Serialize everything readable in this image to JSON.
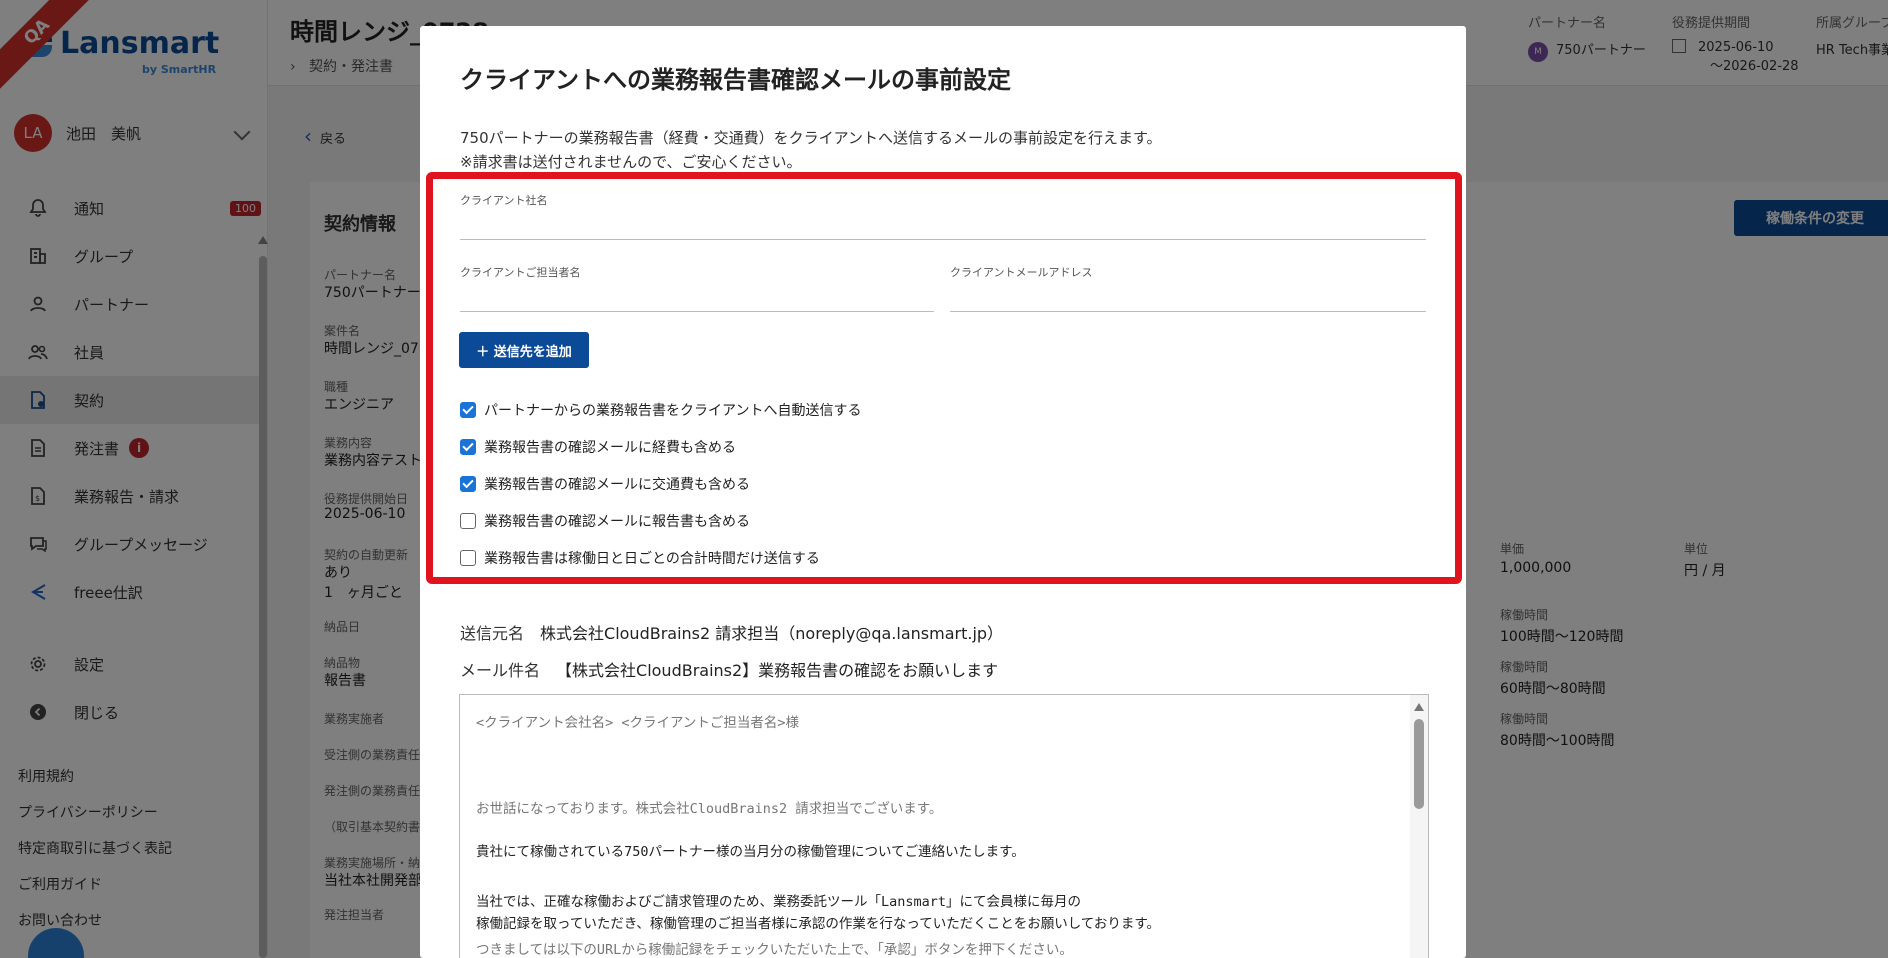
{
  "qa_label": "QA",
  "logo": {
    "name": "Lansmart",
    "sub": "by SmartHR"
  },
  "user": {
    "initials": "LA",
    "name": "池田　美帆"
  },
  "nav": [
    {
      "label": "通知",
      "icon": "bell-icon",
      "badge": "100"
    },
    {
      "label": "グループ",
      "icon": "building-icon"
    },
    {
      "label": "パートナー",
      "icon": "person-icon"
    },
    {
      "label": "社員",
      "icon": "people-icon"
    },
    {
      "label": "契約",
      "icon": "contract-icon",
      "active": true
    },
    {
      "label": "発注書",
      "icon": "document-icon",
      "info": "i"
    },
    {
      "label": "業務報告・請求",
      "icon": "report-icon"
    },
    {
      "label": "グループメッセージ",
      "icon": "chat-icon"
    },
    {
      "label": "freee仕訳",
      "icon": "freee-icon"
    }
  ],
  "nav_bottom": [
    {
      "label": "設定",
      "icon": "gear-icon"
    },
    {
      "label": "閉じる",
      "icon": "close-circle-icon"
    }
  ],
  "footer_links": [
    "利用規約",
    "プライバシーポリシー",
    "特定商取引に基づく表記",
    "ご利用ガイド",
    "お問い合わせ"
  ],
  "header": {
    "title": "時間レンジ_0728",
    "breadcrumb": "契約・発注書",
    "partner_label": "パートナー名",
    "partner_avatar": "M",
    "partner_value": "750パートナー",
    "period_label": "役務提供期間",
    "period_start": "2025-06-10",
    "period_end": "〜2026-02-28",
    "group_label": "所属グループ",
    "group_value": "HR Tech事業"
  },
  "page": {
    "back": "戻る",
    "card_title": "契約情報",
    "change_button": "稼働条件の変更",
    "fields": [
      {
        "label": "パートナー名",
        "value": "750パートナー"
      },
      {
        "label": "案件名",
        "value": "時間レンジ_07"
      },
      {
        "label": "職種",
        "value": "エンジニア"
      },
      {
        "label": "業務内容",
        "value": "業務内容テスト"
      },
      {
        "label": "役務提供開始日",
        "value": "2025-06-10"
      },
      {
        "label": "契約の自動更新",
        "value": "あり"
      },
      {
        "label": "",
        "value": "1　ヶ月ごと"
      },
      {
        "label": "納品日",
        "value": ""
      },
      {
        "label": "納品物",
        "value": "報告書"
      },
      {
        "label": "業務実施者",
        "value": ""
      },
      {
        "label": "受注側の業務責任",
        "value": ""
      },
      {
        "label": "発注側の業務責任",
        "value": ""
      },
      {
        "label": "（取引基本契約書",
        "value": ""
      },
      {
        "label": "業務実施場所・納",
        "value": "当社本社開発部"
      },
      {
        "label": "発注担当者",
        "value": ""
      }
    ],
    "rate_label": "単価",
    "rate_value": "1,000,000",
    "unit_label": "単位",
    "unit_value": "円 / 月",
    "hours": [
      {
        "label": "稼働時間",
        "value": "100時間〜120時間"
      },
      {
        "label": "稼働時間",
        "value": "60時間〜80時間"
      },
      {
        "label": "稼働時間",
        "value": "80時間〜100時間"
      }
    ]
  },
  "modal": {
    "title": "クライアントへの業務報告書確認メールの事前設定",
    "desc_line1": "750パートナーの業務報告書（経費・交通費）をクライアントへ送信するメールの事前設定を行えます。",
    "desc_line2": "※請求書は送付されませんので、ご安心ください。",
    "client_company_label": "クライアント社名",
    "client_company_value": "",
    "client_contact_label": "クライアントご担当者名",
    "client_contact_value": "",
    "client_email_label": "クライアントメールアドレス",
    "client_email_value": "",
    "add_recipient_button": "＋ 送信先を追加",
    "checkboxes": [
      {
        "label": "パートナーからの業務報告書をクライアントへ自動送信する",
        "checked": true
      },
      {
        "label": "業務報告書の確認メールに経費も含める",
        "checked": true
      },
      {
        "label": "業務報告書の確認メールに交通費も含める",
        "checked": true
      },
      {
        "label": "業務報告書の確認メールに報告書も含める",
        "checked": false
      },
      {
        "label": "業務報告書は稼働日と日ごとの合計時間だけ送信する",
        "checked": false
      }
    ],
    "sender_label": "送信元名",
    "sender_value": "株式会社CloudBrains2 請求担当（noreply@qa.lansmart.jp）",
    "subject_label": "メール件名",
    "subject_value": "【株式会社CloudBrains2】業務報告書の確認をお願いします",
    "mail_body": [
      {
        "text": "<クライアント会社名> <クライアントご担当者名>様",
        "muted": true
      },
      {
        "text": "お世話になっております。株式会社CloudBrains2 請求担当でございます。",
        "muted": true
      },
      {
        "text": "貴社にて稼働されている750パートナー様の当月分の稼働管理についてご連絡いたします。",
        "muted": false
      },
      {
        "text": "当社では、正確な稼働およびご請求管理のため、業務委託ツール「Lansmart」にて会員様に毎月の",
        "muted": false
      },
      {
        "text": "稼働記録を取っていただき、稼働管理のご担当者様に承認の作業を行なっていただくことをお願いしております。",
        "muted": false
      },
      {
        "text": "つきましては以下のURLから稼働記録をチェックいただいた上で、「承認」ボタンを押下ください。",
        "muted": true
      }
    ]
  },
  "colors": {
    "brand": "#0b4a96",
    "accent": "#1a73d6",
    "highlight": "#e0141e",
    "badge": "#c0272d"
  }
}
